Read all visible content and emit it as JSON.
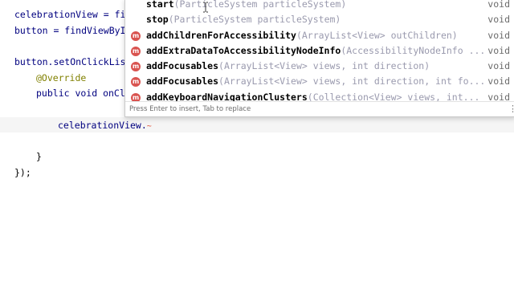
{
  "editor": {
    "lines": [
      {
        "text": "celebrationView = fi"
      },
      {
        "text": "button = findViewById"
      },
      {
        "text": "button.setOnClickLis"
      },
      {
        "text": "@Override"
      },
      {
        "text": "public void onCl"
      },
      {
        "text": "celebrationView."
      },
      {
        "text": "}"
      },
      {
        "text": "});"
      }
    ]
  },
  "completion": {
    "items": [
      {
        "name": "start",
        "params": "(ParticleSystem particleSystem)",
        "return": "void",
        "badge": ""
      },
      {
        "name": "stop",
        "params": "(ParticleSystem particleSystem)",
        "return": "void",
        "badge": ""
      },
      {
        "name": "addChildrenForAccessibility",
        "params": "(ArrayList<View> outChildren)",
        "return": "void",
        "badge": "m"
      },
      {
        "name": "addExtraDataToAccessibilityNodeInfo",
        "params": "(AccessibilityNodeInfo ...",
        "return": "void",
        "badge": "m"
      },
      {
        "name": "addFocusables",
        "params": "(ArrayList<View> views, int direction)",
        "return": "void",
        "badge": "m"
      },
      {
        "name": "addFocusables",
        "params": "(ArrayList<View> views, int direction, int fo...",
        "return": "void",
        "badge": "m"
      },
      {
        "name": "addKeyboardNavigationClusters",
        "params": "(Collection<View> views, int...",
        "return": "void",
        "badge": "m"
      }
    ],
    "footer_hint": "Press Enter to insert, Tab to replace",
    "footer_menu_icon": "⋮"
  },
  "colors": {
    "method_badge": "#d9534f",
    "keyword": "#000080",
    "annotation": "#808000",
    "current_line": "#f5f5f5"
  }
}
